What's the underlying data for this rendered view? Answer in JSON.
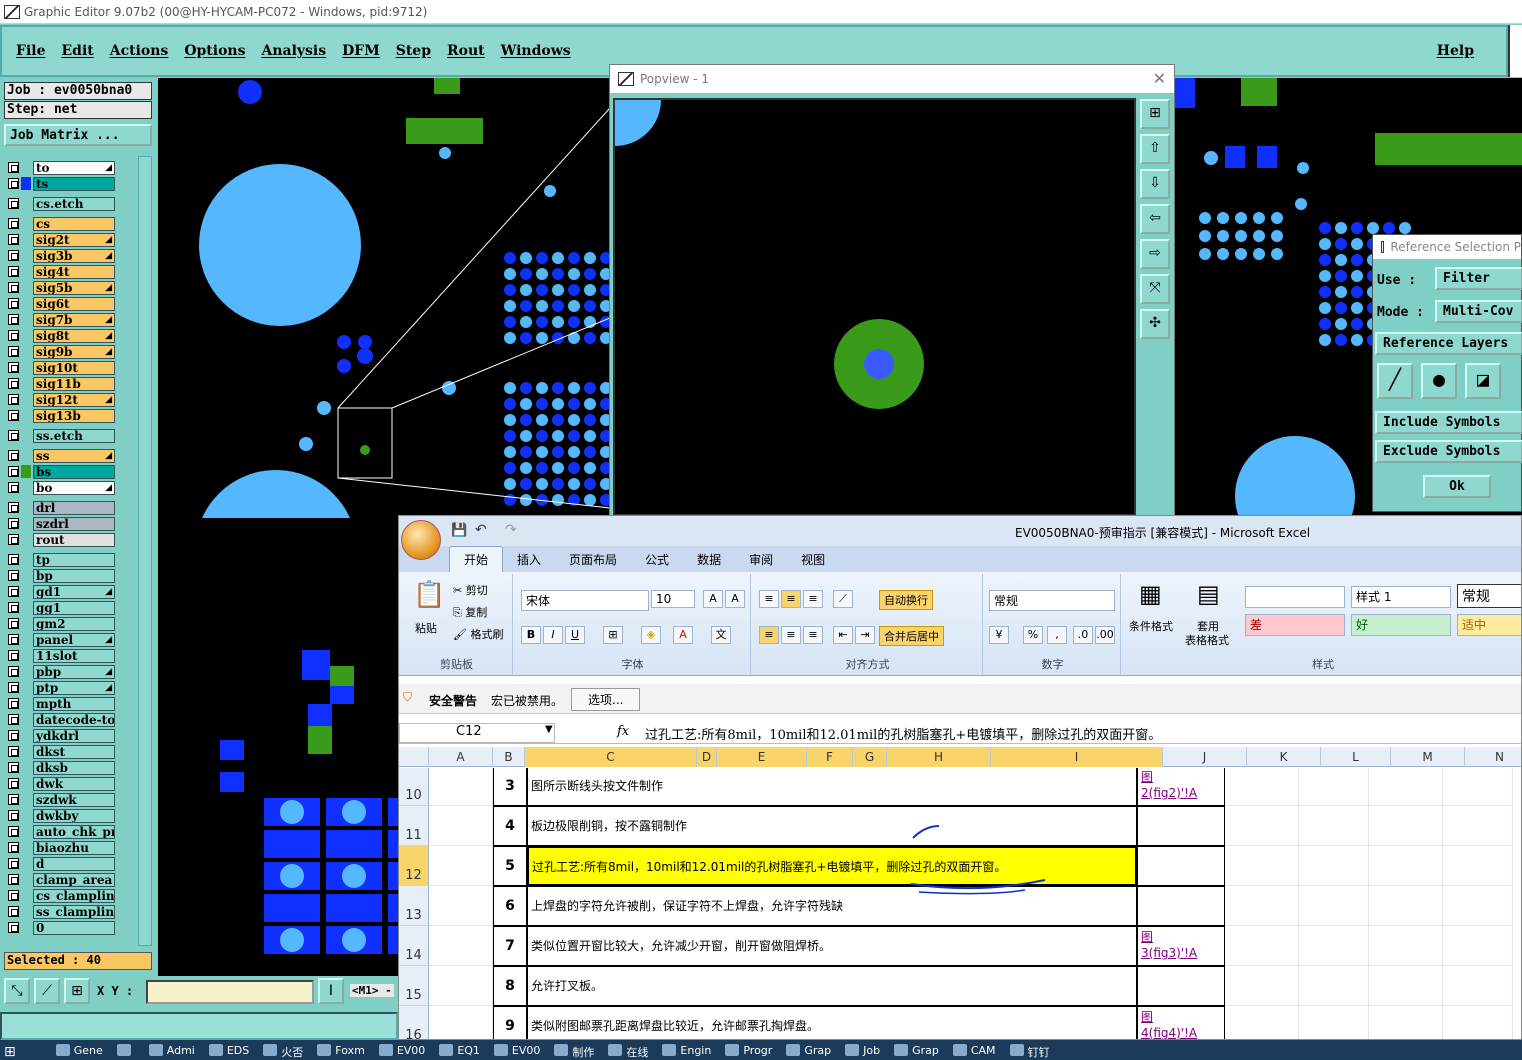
{
  "ge": {
    "title": "Graphic Editor 9.07b2 (00@HY-HYCAM-PC072 - Windows, pid:9712)",
    "menu": [
      "File",
      "Edit",
      "Actions",
      "Options",
      "Analysis",
      "DFM",
      "Step",
      "Rout",
      "Windows"
    ],
    "help": "Help",
    "job": "Job : ev0050bna0",
    "step": "Step: net",
    "job_matrix": "Job Matrix ...",
    "layers": [
      {
        "name": "to",
        "color": "#ffffff",
        "mark": true
      },
      {
        "name": "ts",
        "color": "#00a8a0",
        "mark": false,
        "sw": "#1030ff"
      },
      {
        "name": "cs.etch",
        "color": "#8fd8d0",
        "mark": false,
        "gap": true
      },
      {
        "name": "cs",
        "color": "#f9c864",
        "mark": false,
        "gap": true
      },
      {
        "name": "sig2t",
        "color": "#f9c864",
        "mark": true
      },
      {
        "name": "sig3b",
        "color": "#f9c864",
        "mark": true
      },
      {
        "name": "sig4t",
        "color": "#f9c864",
        "mark": false
      },
      {
        "name": "sig5b",
        "color": "#f9c864",
        "mark": true
      },
      {
        "name": "sig6t",
        "color": "#f9c864",
        "mark": false
      },
      {
        "name": "sig7b",
        "color": "#f9c864",
        "mark": true
      },
      {
        "name": "sig8t",
        "color": "#f9c864",
        "mark": true
      },
      {
        "name": "sig9b",
        "color": "#f9c864",
        "mark": true
      },
      {
        "name": "sig10t",
        "color": "#f9c864",
        "mark": false
      },
      {
        "name": "sig11b",
        "color": "#f9c864",
        "mark": false
      },
      {
        "name": "sig12t",
        "color": "#f9c864",
        "mark": true
      },
      {
        "name": "sig13b",
        "color": "#f9c864",
        "mark": false
      },
      {
        "name": "ss.etch",
        "color": "#8fd8d0",
        "mark": false,
        "gap": true
      },
      {
        "name": "ss",
        "color": "#f9c864",
        "mark": true,
        "gap": true
      },
      {
        "name": "bs",
        "color": "#00a8a0",
        "mark": false,
        "sw": "#3a9a1a"
      },
      {
        "name": "bo",
        "color": "#ffffff",
        "mark": true
      },
      {
        "name": "drl",
        "color": "#a9b8c4",
        "mark": false,
        "gap": true
      },
      {
        "name": "szdrl",
        "color": "#a9b8c4",
        "mark": false
      },
      {
        "name": "rout",
        "color": "#e0e0e0",
        "mark": false
      },
      {
        "name": "tp",
        "color": "#8fd8d0",
        "mark": false,
        "gap": true
      },
      {
        "name": "bp",
        "color": "#8fd8d0",
        "mark": false
      },
      {
        "name": "gd1",
        "color": "#8fd8d0",
        "mark": true
      },
      {
        "name": "gg1",
        "color": "#8fd8d0",
        "mark": false
      },
      {
        "name": "gm2",
        "color": "#8fd8d0",
        "mark": false
      },
      {
        "name": "panel",
        "color": "#8fd8d0",
        "mark": true
      },
      {
        "name": "11slot",
        "color": "#8fd8d0",
        "mark": false
      },
      {
        "name": "pbp",
        "color": "#8fd8d0",
        "mark": true
      },
      {
        "name": "ptp",
        "color": "#8fd8d0",
        "mark": true
      },
      {
        "name": "mpth",
        "color": "#8fd8d0",
        "mark": false
      },
      {
        "name": "datecode-to",
        "color": "#8fd8d0",
        "mark": false
      },
      {
        "name": "ydkdrl",
        "color": "#8fd8d0",
        "mark": false
      },
      {
        "name": "dkst",
        "color": "#8fd8d0",
        "mark": false
      },
      {
        "name": "dksb",
        "color": "#8fd8d0",
        "mark": false
      },
      {
        "name": "dwk",
        "color": "#8fd8d0",
        "mark": false
      },
      {
        "name": "szdwk",
        "color": "#8fd8d0",
        "mark": false
      },
      {
        "name": "dwkby",
        "color": "#8fd8d0",
        "mark": false
      },
      {
        "name": "auto_chk_pn",
        "color": "#8fd8d0",
        "mark": false
      },
      {
        "name": "biaozhu",
        "color": "#8fd8d0",
        "mark": false
      },
      {
        "name": "d",
        "color": "#8fd8d0",
        "mark": false
      },
      {
        "name": "clamp_area",
        "color": "#8fd8d0",
        "mark": false
      },
      {
        "name": "cs_clampline",
        "color": "#8fd8d0",
        "mark": false
      },
      {
        "name": "ss_clampline",
        "color": "#8fd8d0",
        "mark": false
      },
      {
        "name": "0",
        "color": "#8fd8d0",
        "mark": false
      }
    ],
    "selected": "Selected : 40",
    "xy_label": "X Y :",
    "m1": "<M1> -"
  },
  "popview": {
    "title": "Popview - 1"
  },
  "refsel": {
    "title": "Reference Selection P",
    "use_label": "Use :",
    "use_val": "Filter",
    "mode_label": "Mode :",
    "mode_val": "Multi-Cov",
    "ref_layers": "Reference Layers",
    "include": "Include Symbols",
    "exclude": "Exclude Symbols",
    "ok": "Ok"
  },
  "excel": {
    "title": "EV0050BNA0-预审指示  [兼容模式] - Microsoft Excel",
    "tabs": [
      "开始",
      "插入",
      "页面布局",
      "公式",
      "数据",
      "审阅",
      "视图"
    ],
    "clip": {
      "paste": "粘贴",
      "cut": "剪切",
      "copy": "复制",
      "fmt": "格式刷",
      "label": "剪贴板"
    },
    "font": {
      "name": "宋体",
      "size": "10",
      "label": "字体"
    },
    "align": {
      "wrap": "自动换行",
      "merge": "合并后居中",
      "label": "对齐方式"
    },
    "number": {
      "fmt": "常规",
      "label": "数字"
    },
    "styles": {
      "cond": "条件格式",
      "table1": "套用",
      "table2": "表格格式",
      "s1": "样式 1",
      "s2": "常规",
      "bad": "差",
      "good": "好",
      "neutral": "适中",
      "label": "样式"
    },
    "security": {
      "label": "安全警告",
      "msg": "宏已被禁用。",
      "btn": "选项..."
    },
    "cellref": "C12",
    "fx": "fx",
    "formula": "过孔工艺:所有8mil，10mil和12.01mil的孔树脂塞孔+电镀填平，删除过孔的双面开窗。",
    "columns": [
      "A",
      "B",
      "C",
      "D",
      "E",
      "F",
      "G",
      "H",
      "I",
      "J",
      "K",
      "L",
      "M",
      "N"
    ],
    "rows": [
      {
        "num": "10",
        "b": "3",
        "c": "图所示断线头按文件制作",
        "j1": "图",
        "j2": "2(fig2)'!A"
      },
      {
        "num": "11",
        "b": "4",
        "c": "板边极限削铜，按不露铜制作",
        "j1": "",
        "j2": ""
      },
      {
        "num": "12",
        "b": "5",
        "c": "过孔工艺:所有8mil，10mil和12.01mil的孔树脂塞孔+电镀填平，删除过孔的双面开窗。",
        "j1": "",
        "j2": ""
      },
      {
        "num": "13",
        "b": "6",
        "c": "上焊盘的字符允许被削，保证字符不上焊盘，允许字符残缺",
        "j1": "",
        "j2": ""
      },
      {
        "num": "14",
        "b": "7",
        "c": "类似位置开窗比较大，允许减少开窗，削开窗做阻焊桥。",
        "j1": "图",
        "j2": "3(fig3)'!A"
      },
      {
        "num": "15",
        "b": "8",
        "c": "允许打叉板。",
        "j1": "",
        "j2": ""
      },
      {
        "num": "16",
        "b": "9",
        "c": "类似附图邮票孔距离焊盘比较近，允许邮票孔掏焊盘。",
        "j1": "图",
        "j2": "4(fig4)'!A"
      }
    ]
  },
  "taskbar": [
    "Gene",
    "",
    "Admi",
    "EDS",
    "火否",
    "Foxm",
    "EV00",
    "EQ1",
    "EV00",
    "制作",
    "在线",
    "Engin",
    "Progr",
    "Grap",
    "Job",
    "Grap",
    "CAM",
    "钉钉"
  ]
}
